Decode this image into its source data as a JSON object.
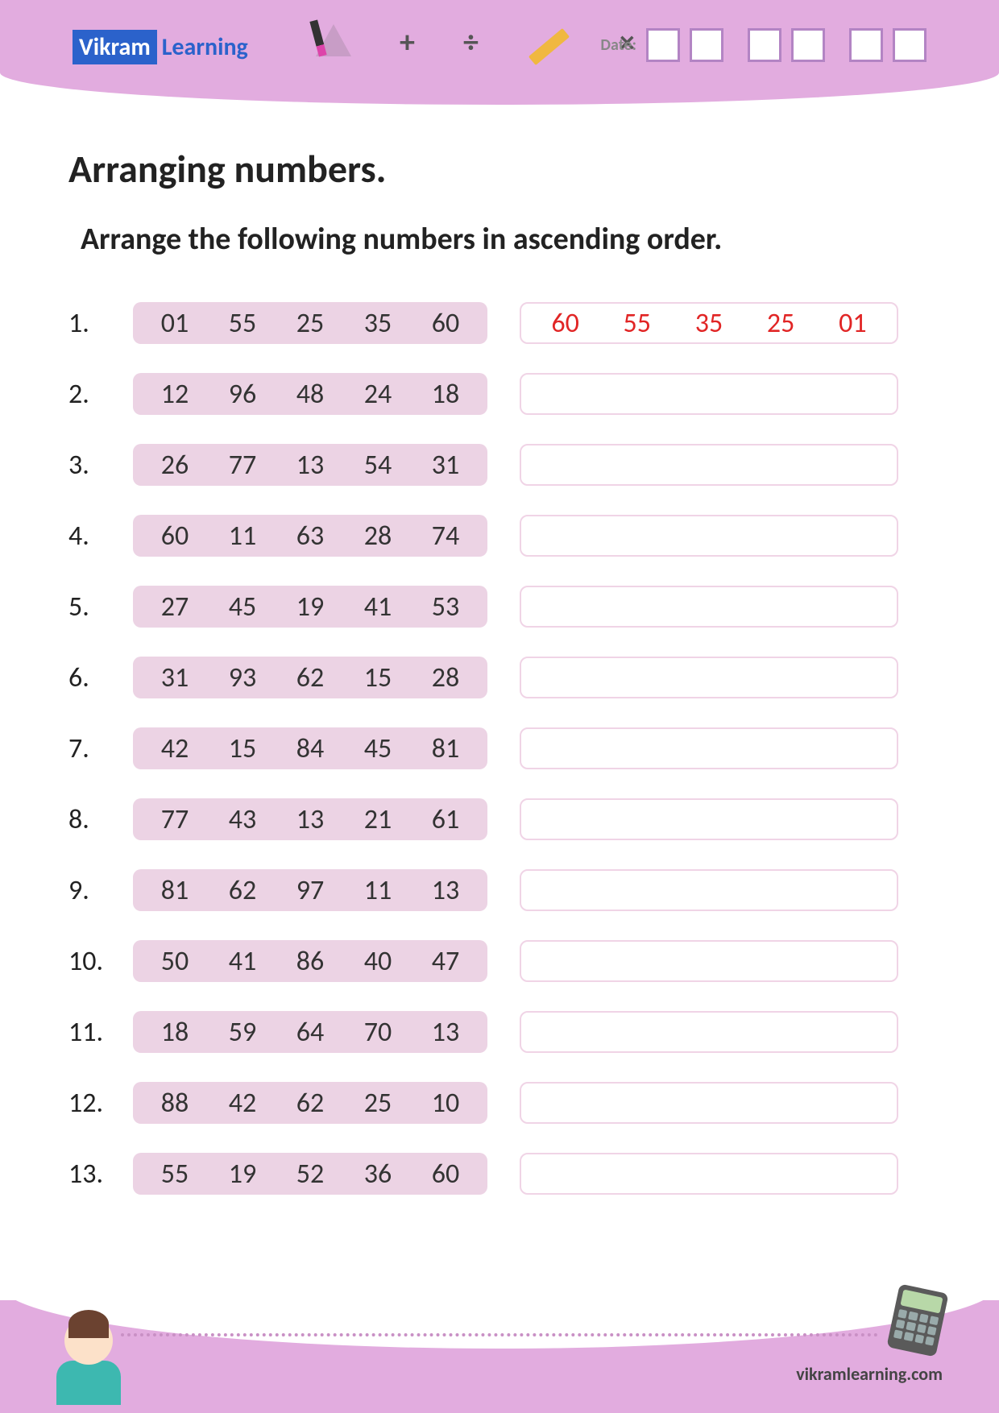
{
  "header": {
    "brand1": "Vikram",
    "brand2": "Learning",
    "dateLabel": "Date:",
    "symbols": {
      "plus": "+",
      "div": "÷",
      "mult": "×"
    }
  },
  "title": "Arranging numbers.",
  "subtitle": "Arrange the following numbers in ascending order.",
  "exampleAnswer": [
    "60",
    "55",
    "35",
    "25",
    "01"
  ],
  "rows": [
    {
      "n": "1.",
      "v": [
        "01",
        "55",
        "25",
        "35",
        "60"
      ]
    },
    {
      "n": "2.",
      "v": [
        "12",
        "96",
        "48",
        "24",
        "18"
      ]
    },
    {
      "n": "3.",
      "v": [
        "26",
        "77",
        "13",
        "54",
        "31"
      ]
    },
    {
      "n": "4.",
      "v": [
        "60",
        "11",
        "63",
        "28",
        "74"
      ]
    },
    {
      "n": "5.",
      "v": [
        "27",
        "45",
        "19",
        "41",
        "53"
      ]
    },
    {
      "n": "6.",
      "v": [
        "31",
        "93",
        "62",
        "15",
        "28"
      ]
    },
    {
      "n": "7.",
      "v": [
        "42",
        "15",
        "84",
        "45",
        "81"
      ]
    },
    {
      "n": "8.",
      "v": [
        "77",
        "43",
        "13",
        "21",
        "61"
      ]
    },
    {
      "n": "9.",
      "v": [
        "81",
        "62",
        "97",
        "11",
        "13"
      ]
    },
    {
      "n": "10.",
      "v": [
        "50",
        "41",
        "86",
        "40",
        "47"
      ]
    },
    {
      "n": "11.",
      "v": [
        "18",
        "59",
        "64",
        "70",
        "13"
      ]
    },
    {
      "n": "12.",
      "v": [
        "88",
        "42",
        "62",
        "25",
        "10"
      ]
    },
    {
      "n": "13.",
      "v": [
        "55",
        "19",
        "52",
        "36",
        "60"
      ]
    }
  ],
  "footer": {
    "url": "vikramlearning.com"
  }
}
